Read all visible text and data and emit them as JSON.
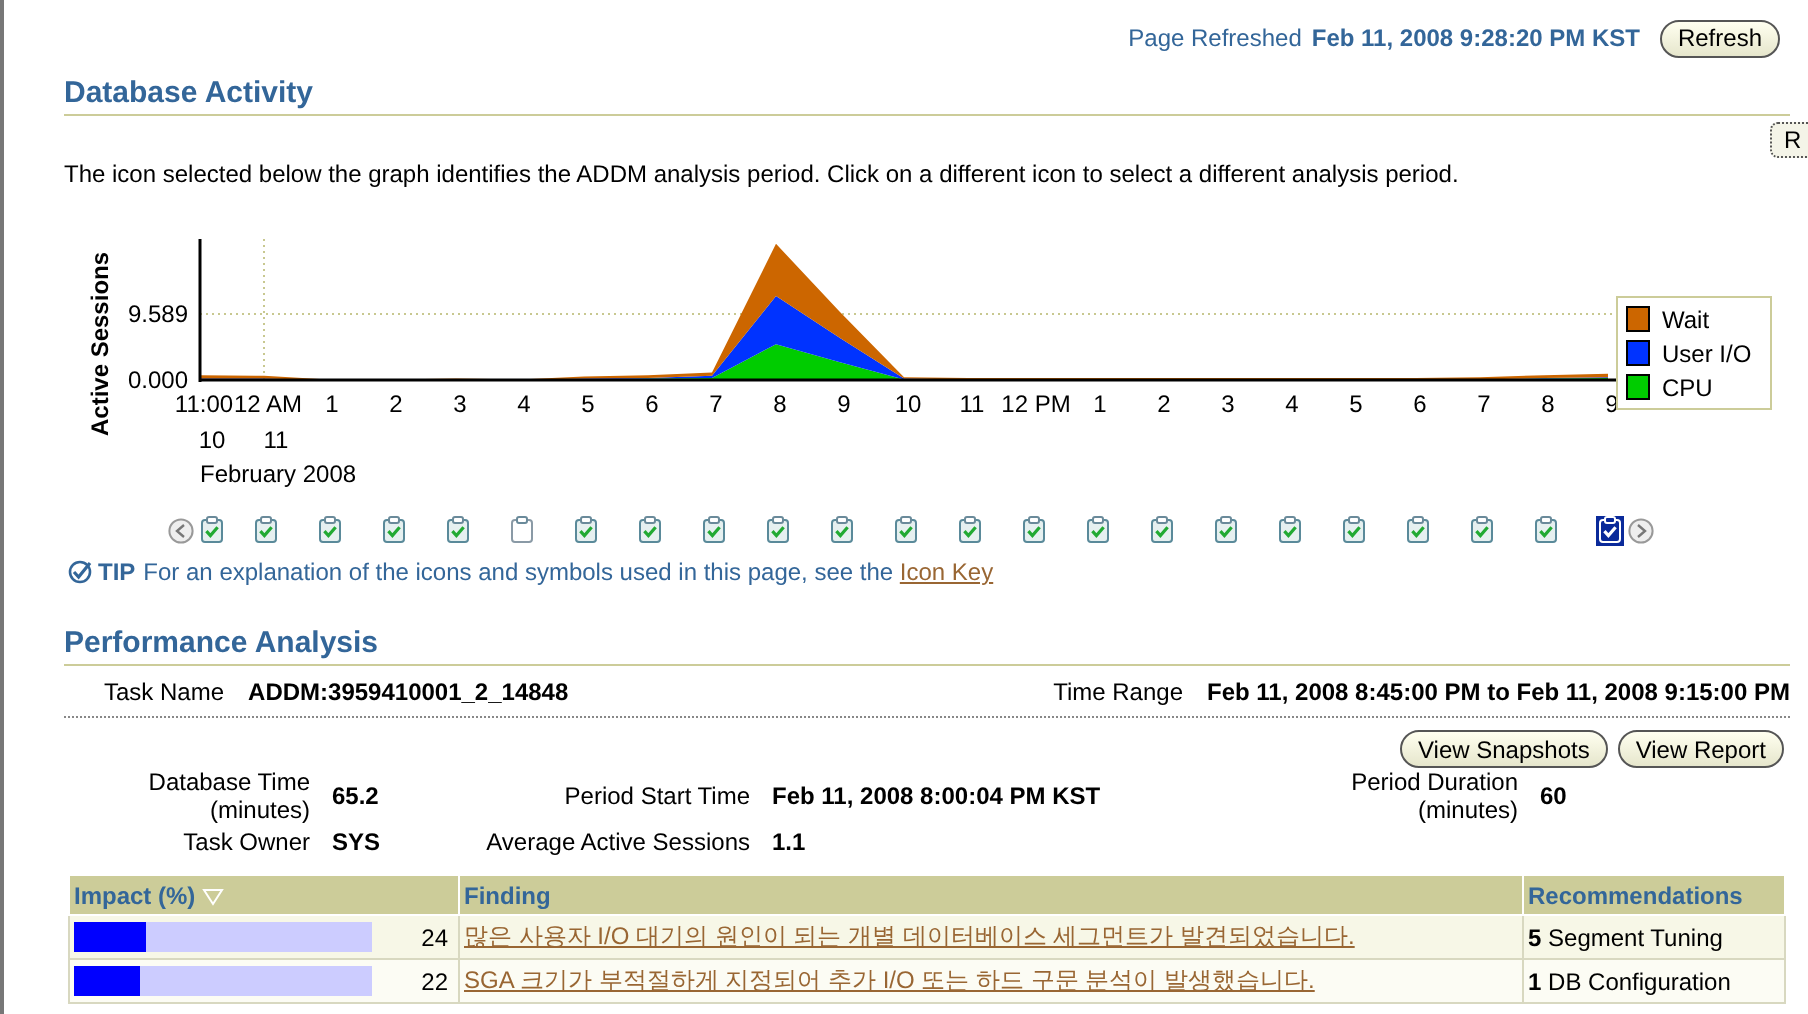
{
  "header": {
    "refreshed_label": "Page Refreshed",
    "refreshed_value": "Feb 11, 2008 9:28:20 PM KST",
    "refresh_button": "Refresh",
    "side_button": "R"
  },
  "activity": {
    "title": "Database Activity",
    "description": "The icon selected below the graph identifies the ADDM analysis period. Click on a different icon to select a different analysis period.",
    "chart_data": {
      "type": "area",
      "stacked": true,
      "legend": "right",
      "ylabel": "Active Sessions",
      "xlabel": "February 2008",
      "categories": [
        "11:00",
        "12 AM",
        "1",
        "2",
        "3",
        "4",
        "5",
        "6",
        "7",
        "8",
        "9",
        "10",
        "11",
        "12 PM",
        "1",
        "2",
        "3",
        "4",
        "5",
        "6",
        "7",
        "8",
        "9"
      ],
      "ylim": [
        0,
        20.5
      ],
      "yticks": [
        {
          "value": 0,
          "label": "0.000"
        },
        {
          "value": 9.589,
          "label": "9.589"
        }
      ],
      "series": [
        {
          "name": "Wait",
          "color": "#cc6600",
          "values": [
            0.5,
            0.4,
            0.1,
            0.1,
            0.2,
            0.1,
            0.3,
            0.4,
            0.5,
            7.6,
            3.8,
            0.2,
            0.2,
            0.2,
            0.2,
            0.2,
            0.2,
            0.2,
            0.2,
            0.2,
            0.3,
            0.4,
            0.5
          ]
        },
        {
          "name": "User I/O",
          "color": "#0033ff",
          "values": [
            0.1,
            0.1,
            0,
            0,
            0,
            0,
            0.1,
            0.1,
            0.3,
            7.0,
            3.5,
            0.1,
            0,
            0,
            0,
            0,
            0,
            0,
            0,
            0,
            0,
            0.1,
            0.1
          ]
        },
        {
          "name": "CPU",
          "color": "#00cc00",
          "values": [
            0.1,
            0.1,
            0,
            0,
            0,
            0,
            0.1,
            0.2,
            0.3,
            5.2,
            2.6,
            0.1,
            0.1,
            0.1,
            0.1,
            0.1,
            0.1,
            0.1,
            0.1,
            0.1,
            0.1,
            0.2,
            0.3
          ]
        }
      ]
    },
    "day_labels": [
      "10",
      "11"
    ],
    "snapshots": [
      {
        "kind": "ok",
        "selected": false
      },
      {
        "kind": "ok",
        "selected": false
      },
      {
        "kind": "ok",
        "selected": false
      },
      {
        "kind": "ok",
        "selected": false
      },
      {
        "kind": "ok",
        "selected": false
      },
      {
        "kind": "empty",
        "selected": false
      },
      {
        "kind": "ok",
        "selected": false
      },
      {
        "kind": "ok",
        "selected": false
      },
      {
        "kind": "ok",
        "selected": false
      },
      {
        "kind": "ok",
        "selected": false
      },
      {
        "kind": "ok",
        "selected": false
      },
      {
        "kind": "ok",
        "selected": false
      },
      {
        "kind": "ok",
        "selected": false
      },
      {
        "kind": "ok",
        "selected": false
      },
      {
        "kind": "ok",
        "selected": false
      },
      {
        "kind": "ok",
        "selected": false
      },
      {
        "kind": "ok",
        "selected": false
      },
      {
        "kind": "ok",
        "selected": false
      },
      {
        "kind": "ok",
        "selected": false
      },
      {
        "kind": "ok",
        "selected": false
      },
      {
        "kind": "ok",
        "selected": false
      },
      {
        "kind": "ok",
        "selected": false
      },
      {
        "kind": "ok",
        "selected": true
      }
    ],
    "tip_label": "TIP",
    "tip_text": "For an explanation of the icons and symbols used in this page, see the",
    "tip_link": "Icon Key"
  },
  "analysis": {
    "title": "Performance Analysis",
    "task_name_label": "Task Name",
    "task_name": "ADDM:3959410001_2_14848",
    "time_range_label": "Time Range",
    "time_range": "Feb 11, 2008 8:45:00 PM to Feb 11, 2008 9:15:00 PM",
    "buttons": [
      "View Snapshots",
      "View Report"
    ],
    "fields": [
      {
        "label": "Database Time (minutes)",
        "value": "65.2"
      },
      {
        "label": "Period Start Time",
        "value": "Feb 11, 2008 8:00:04 PM KST"
      },
      {
        "label": "Period Duration (minutes)",
        "value": "60"
      },
      {
        "label": "Task Owner",
        "value": "SYS"
      },
      {
        "label": "Average Active Sessions",
        "value": "1.1"
      }
    ]
  },
  "findings": {
    "columns": [
      "Impact (%)",
      "Finding",
      "Recommendations"
    ],
    "rows": [
      {
        "level": 0.24,
        "impact": "24",
        "finding": "많은 사용자 I/O 대기의 원인이 되는 개별 데이터베이스 세그먼트가 발견되었습니다.",
        "recommendation": "**5** Segment Tuning"
      },
      {
        "level": 0.22,
        "impact": "22",
        "finding": "SGA 크기가 부적절하게 지정되어 추가 I/O 또는 하드 구문 분석이 발생했습니다.",
        "recommendation": "**1** DB Configuration"
      }
    ]
  }
}
